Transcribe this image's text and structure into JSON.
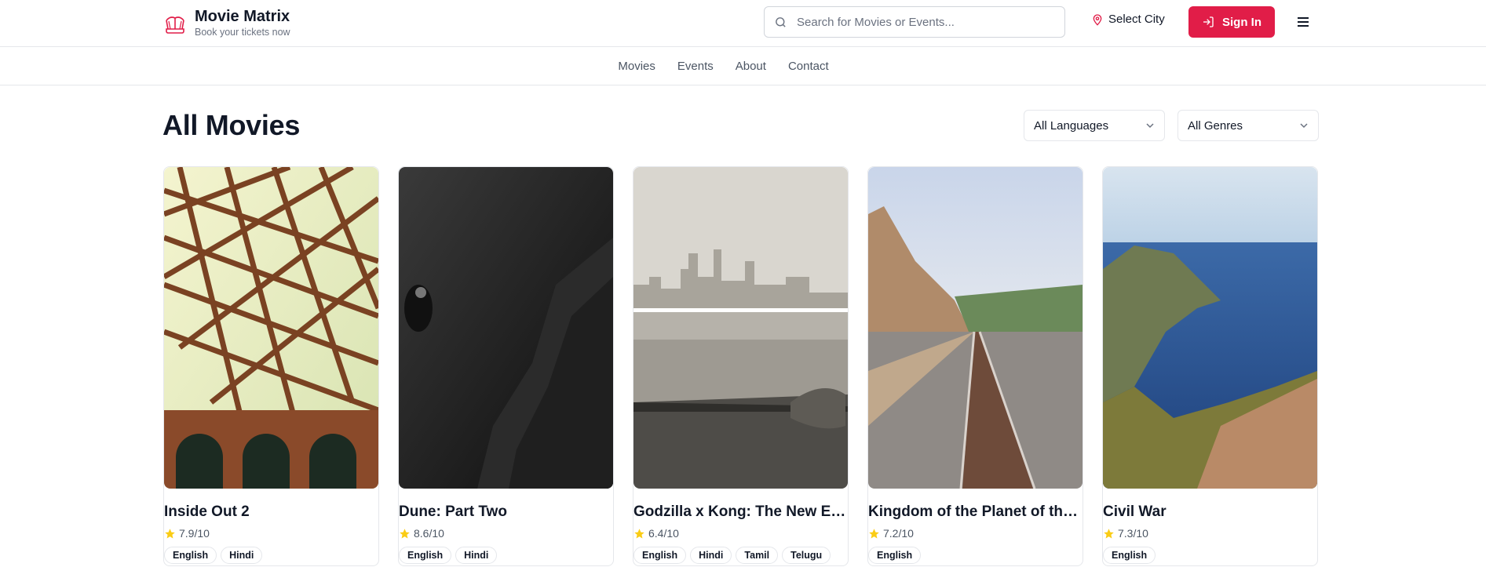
{
  "brand": {
    "name": "Movie Matrix",
    "tagline": "Book your tickets now",
    "accent": "#e11d48"
  },
  "search": {
    "placeholder": "Search for Movies or Events...",
    "icon": "search-icon"
  },
  "city": {
    "label": "Select City",
    "icon": "map-pin-icon"
  },
  "signin": {
    "label": "Sign In",
    "icon": "login-icon"
  },
  "menu": {
    "icon": "hamburger-menu-icon"
  },
  "nav": {
    "items": [
      "Movies",
      "Events",
      "About",
      "Contact"
    ]
  },
  "page": {
    "title": "All Movies"
  },
  "filters": {
    "language": "All Languages",
    "genre": "All Genres"
  },
  "movies": [
    {
      "title": "Inside Out 2",
      "rating": "7.9/10",
      "languages": [
        "English",
        "Hindi"
      ]
    },
    {
      "title": "Dune: Part Two",
      "rating": "8.6/10",
      "languages": [
        "English",
        "Hindi"
      ]
    },
    {
      "title": "Godzilla x Kong: The New Empire",
      "rating": "6.4/10",
      "languages": [
        "English",
        "Hindi",
        "Tamil",
        "Telugu"
      ]
    },
    {
      "title": "Kingdom of the Planet of the Apes",
      "rating": "7.2/10",
      "languages": [
        "English"
      ]
    },
    {
      "title": "Civil War",
      "rating": "7.3/10",
      "languages": [
        "English"
      ]
    }
  ]
}
